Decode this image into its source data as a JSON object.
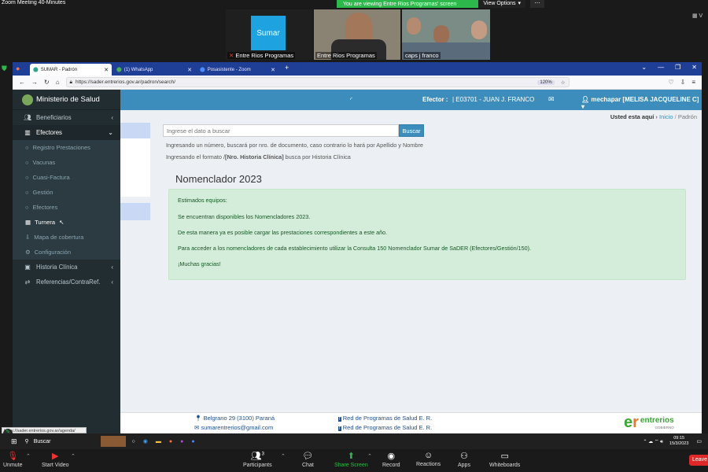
{
  "zoom": {
    "meeting_title": "Zoom Meeting 40-Minutes",
    "share_banner": "You are viewing Entre Rios Programas' screen",
    "view_options": "View Options",
    "participants": [
      {
        "name": "Entre Rios Programas",
        "tile_label": "Sumar"
      },
      {
        "name": "Entre Rios Programas"
      },
      {
        "name": "caps j franco"
      }
    ],
    "controls": {
      "unmute": "Unmute",
      "start_video": "Start Video",
      "participants": "Participants",
      "participants_count": "3",
      "chat": "Chat",
      "share_screen": "Share Screen",
      "record": "Record",
      "reactions": "Reactions",
      "apps": "Apps",
      "whiteboards": "Whiteboards",
      "leave": "Leave"
    }
  },
  "browser": {
    "tabs": [
      {
        "label": "SUMAR - Padrón"
      },
      {
        "label": "(1) WhatsApp"
      },
      {
        "label": "Posasistente - Zoom"
      }
    ],
    "url": "https://sader.entrerios.gov.ar/padron/search/",
    "zoom_level": "120%",
    "status_url": "https://sader.entrerios.gov.ar/agenda/"
  },
  "app": {
    "brand": "Ministerio de Salud",
    "navbar": {
      "efector_label": "Efector :",
      "efector_value": "| E03701 - JUAN J. FRANCO",
      "user": "mechapar [MELISA JACQUELINE C]"
    },
    "sidebar": {
      "beneficiarios": "Beneficiarios",
      "efectores": "Efectores",
      "sub_items": [
        "Registro Prestaciones",
        "Vacunas",
        "Cuasi-Factura",
        "Gestión",
        "Efectores",
        "Turnera",
        "Mapa de cobertura",
        "Configuración"
      ],
      "historia_clinica": "Historia Clínica",
      "referencias": "Referencias/ContraRef."
    },
    "breadcrumb": {
      "prefix": "Usted esta aquí",
      "inicio": "Inicio",
      "separator": "/",
      "current": "Padrón"
    },
    "search": {
      "placeholder": "Ingrese el dato a buscar",
      "button": "Buscar",
      "help1": "Ingresando un número, buscará por nro. de documento, caso contrario lo hará por Apellido y Nombre",
      "help2_pre": "Ingresando el formato /",
      "help2_bold": "[Nro. Historia Clínica]",
      "help2_post": " busca por Historia Clínica"
    },
    "notice": {
      "title": "Nomenclador 2023",
      "lines": [
        "Estimados equipos:",
        "Se encuentran disponibles los Nomencladores 2023.",
        "De esta manera ya es posible cargar las prestaciones correspondientes a este año.",
        "Para acceder a los nomencladores de cada establecimiento utilizar la Consulta 150 Nomenclador Sumar de SaDER (Efectores/Gestión/150).",
        "¡Muchas gracias!"
      ]
    },
    "footer": {
      "address": "Belgrano 29 (3100) Paraná",
      "email": "sumarentrerios@gmail.com",
      "fb1": "Red de Programas de Salud E. R.",
      "fb2": "Red de Programas de Salud E. R.",
      "logo_text": "entrerios",
      "logo_sub": "GOBIERNO"
    }
  },
  "taskbar": {
    "search": "Buscar",
    "time": "09:15",
    "date": "15/3/2023"
  },
  "colors": {
    "navbar": "#3c8dbc",
    "sidebar": "#222d32",
    "notice_bg": "#d4edda",
    "notice_text": "#155724",
    "share_banner": "#2db84b"
  }
}
